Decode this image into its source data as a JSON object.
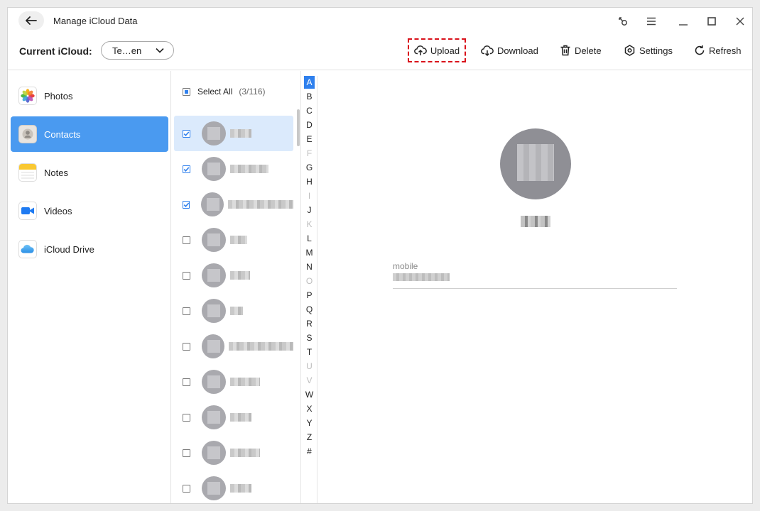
{
  "app": {
    "title": "Manage iCloud Data"
  },
  "toolbar": {
    "current_label": "Current iCloud:",
    "account": "Te…en",
    "upload": "Upload",
    "download": "Download",
    "delete": "Delete",
    "settings": "Settings",
    "refresh": "Refresh"
  },
  "sidebar": {
    "items": [
      {
        "label": "Photos",
        "icon": "photos-icon"
      },
      {
        "label": "Contacts",
        "icon": "contacts-icon",
        "active": true
      },
      {
        "label": "Notes",
        "icon": "notes-icon"
      },
      {
        "label": "Videos",
        "icon": "videos-icon"
      },
      {
        "label": "iCloud Drive",
        "icon": "icloud-drive-icon"
      }
    ]
  },
  "list": {
    "select_all": "Select All",
    "count": "(3/116)"
  },
  "alphabet": [
    "A",
    "B",
    "C",
    "D",
    "E",
    "F",
    "G",
    "H",
    "I",
    "J",
    "K",
    "L",
    "M",
    "N",
    "O",
    "P",
    "Q",
    "R",
    "S",
    "T",
    "U",
    "V",
    "W",
    "X",
    "Y",
    "Z",
    "#"
  ],
  "alphabet_disabled": [
    "F",
    "I",
    "K",
    "O",
    "U",
    "V"
  ],
  "alphabet_current": "A",
  "detail": {
    "field_label": "mobile"
  },
  "colors": {
    "accent": "#2f80ed",
    "sidebar_active": "#4a9af0",
    "upload_highlight": "#d9121b"
  }
}
